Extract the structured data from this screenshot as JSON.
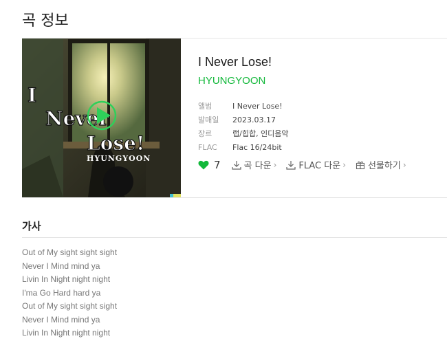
{
  "page": {
    "title": "곡 정보"
  },
  "song": {
    "title": "I Never Lose!",
    "artist": "HYUNGYOON",
    "cover": {
      "art_line1": "I",
      "art_line2": "Never",
      "art_line3": "Lose!",
      "art_artist": "HYUNGYOON"
    },
    "meta": [
      {
        "label": "앨범",
        "value": "I Never Lose!"
      },
      {
        "label": "발매일",
        "value": "2023.03.17"
      },
      {
        "label": "장르",
        "value": "랩/힙합, 인디음악"
      },
      {
        "label": "FLAC",
        "value": "Flac 16/24bit"
      }
    ]
  },
  "actions": {
    "like_count": "7",
    "download_song": "곡 다운",
    "download_flac": "FLAC 다운",
    "gift": "선물하기"
  },
  "lyrics": {
    "title": "가사",
    "lines": [
      "Out of My sight sight sight",
      "Never I Mind mind ya",
      "Livin In Night night night",
      "I'ma Go Hard hard ya",
      "Out of My sight sight sight",
      "Never I Mind mind ya",
      "Livin In Night night night"
    ]
  },
  "colors": {
    "accent": "#12b83a",
    "text": "#333333",
    "muted": "#9a9a9a"
  }
}
